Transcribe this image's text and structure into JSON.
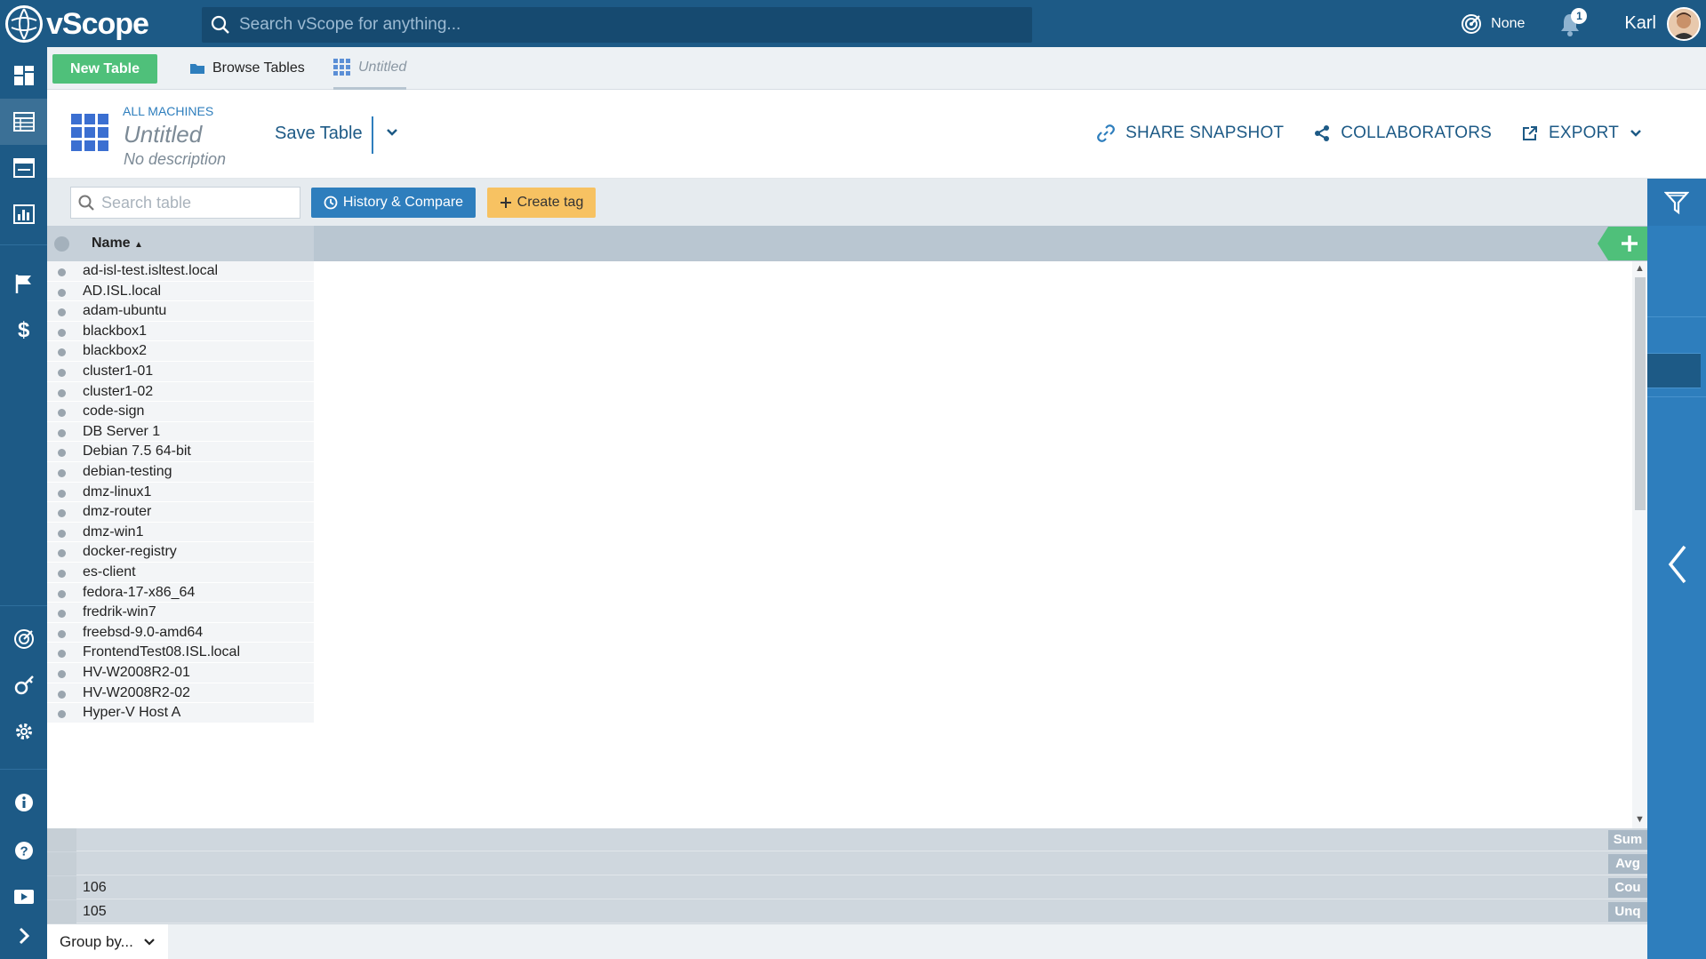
{
  "app": {
    "logo_text": "vScope",
    "search_placeholder": "Search vScope for anything...",
    "environment": "None",
    "notifications_count": "1",
    "user_name": "Karl"
  },
  "tabs": {
    "new_table_label": "New Table",
    "browse_label": "Browse Tables",
    "current_label": "Untitled"
  },
  "header": {
    "breadcrumb": "ALL MACHINES",
    "title": "Untitled",
    "description": "No description",
    "save_label": "Save Table",
    "share_label": "SHARE SNAPSHOT",
    "collaborators_label": "COLLABORATORS",
    "export_label": "EXPORT"
  },
  "toolbar": {
    "search_placeholder": "Search table",
    "history_label": "History & Compare",
    "tag_label": "Create tag"
  },
  "table": {
    "column_header": "Name",
    "rows": [
      "ad-isl-test.isltest.local",
      "AD.ISL.local",
      "adam-ubuntu",
      "blackbox1",
      "blackbox2",
      "cluster1-01",
      "cluster1-02",
      "code-sign",
      "DB Server 1",
      "Debian 7.5 64-bit",
      "debian-testing",
      "dmz-linux1",
      "dmz-router",
      "dmz-win1",
      "docker-registry",
      "es-client",
      "fedora-17-x86_64",
      "fredrik-win7",
      "freebsd-9.0-amd64",
      "FrontendTest08.ISL.local",
      "HV-W2008R2-01",
      "HV-W2008R2-02",
      "Hyper-V Host A"
    ]
  },
  "summary": {
    "rows": [
      {
        "value": "",
        "label": "Sum"
      },
      {
        "value": "",
        "label": "Avg"
      },
      {
        "value": "106",
        "label": "Cou"
      },
      {
        "value": "105",
        "label": "Unq"
      }
    ]
  },
  "footer": {
    "group_by_label": "Group by..."
  },
  "colors": {
    "brand": "#1d5a86",
    "accent_blue": "#2e7ebd",
    "green": "#4fc07a",
    "yellow": "#f7c262"
  }
}
